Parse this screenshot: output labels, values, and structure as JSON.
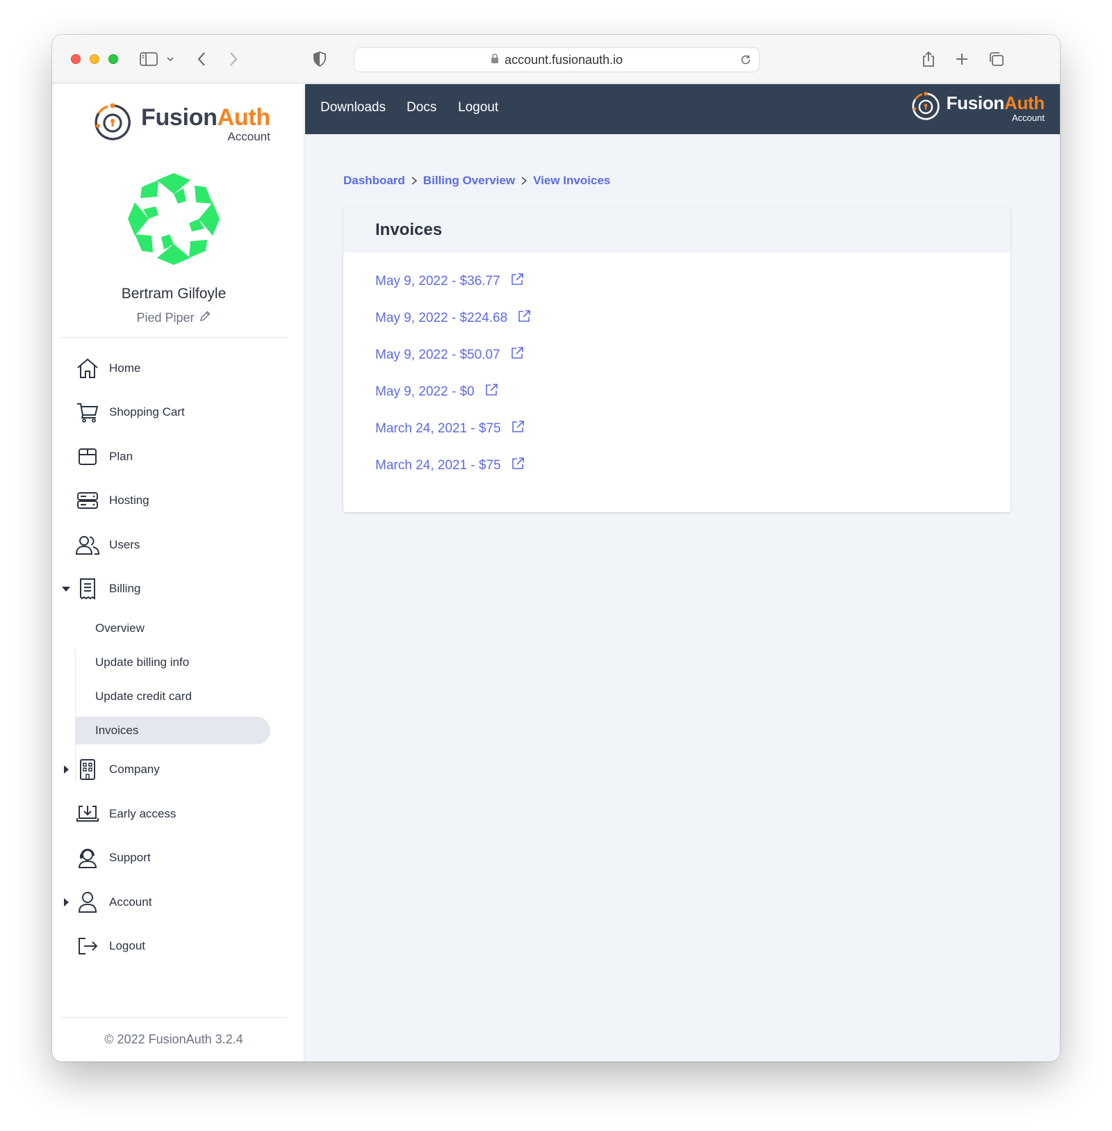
{
  "browser": {
    "url": "account.fusionauth.io"
  },
  "brand": {
    "word_1": "Fusion",
    "word_2": "Auth",
    "sub": "Account"
  },
  "topnav": {
    "links": [
      "Downloads",
      "Docs",
      "Logout"
    ]
  },
  "user": {
    "name": "Bertram Gilfoyle",
    "org": "Pied Piper"
  },
  "sidebar": {
    "items": [
      {
        "label": "Home",
        "icon": "home-icon"
      },
      {
        "label": "Shopping Cart",
        "icon": "cart-icon"
      },
      {
        "label": "Plan",
        "icon": "package-icon"
      },
      {
        "label": "Hosting",
        "icon": "server-icon"
      },
      {
        "label": "Users",
        "icon": "users-icon"
      },
      {
        "label": "Billing",
        "icon": "receipt-icon",
        "expanded": true
      },
      {
        "label": "Company",
        "icon": "building-icon",
        "expanded": false
      },
      {
        "label": "Early access",
        "icon": "download-icon"
      },
      {
        "label": "Support",
        "icon": "support-icon"
      },
      {
        "label": "Account",
        "icon": "user-icon",
        "expanded": false
      },
      {
        "label": "Logout",
        "icon": "logout-icon"
      }
    ],
    "billing_sub": [
      "Overview",
      "Update billing info",
      "Update credit card",
      "Invoices"
    ],
    "active_sub": "Invoices"
  },
  "breadcrumb": [
    "Dashboard",
    "Billing Overview",
    "View Invoices"
  ],
  "invoices": {
    "title": "Invoices",
    "items": [
      "May 9, 2022 - $36.77",
      "May 9, 2022 - $224.68",
      "May 9, 2022 - $50.07",
      "May 9, 2022 - $0",
      "March 24, 2021 - $75",
      "March 24, 2021 - $75"
    ]
  },
  "footer": {
    "copyright": "© 2022 FusionAuth 3.2.4"
  },
  "colors": {
    "accent": "#5c6ae6",
    "brand_orange": "#f58320",
    "topbar": "#334155",
    "avatar_green": "#2ee86a"
  }
}
